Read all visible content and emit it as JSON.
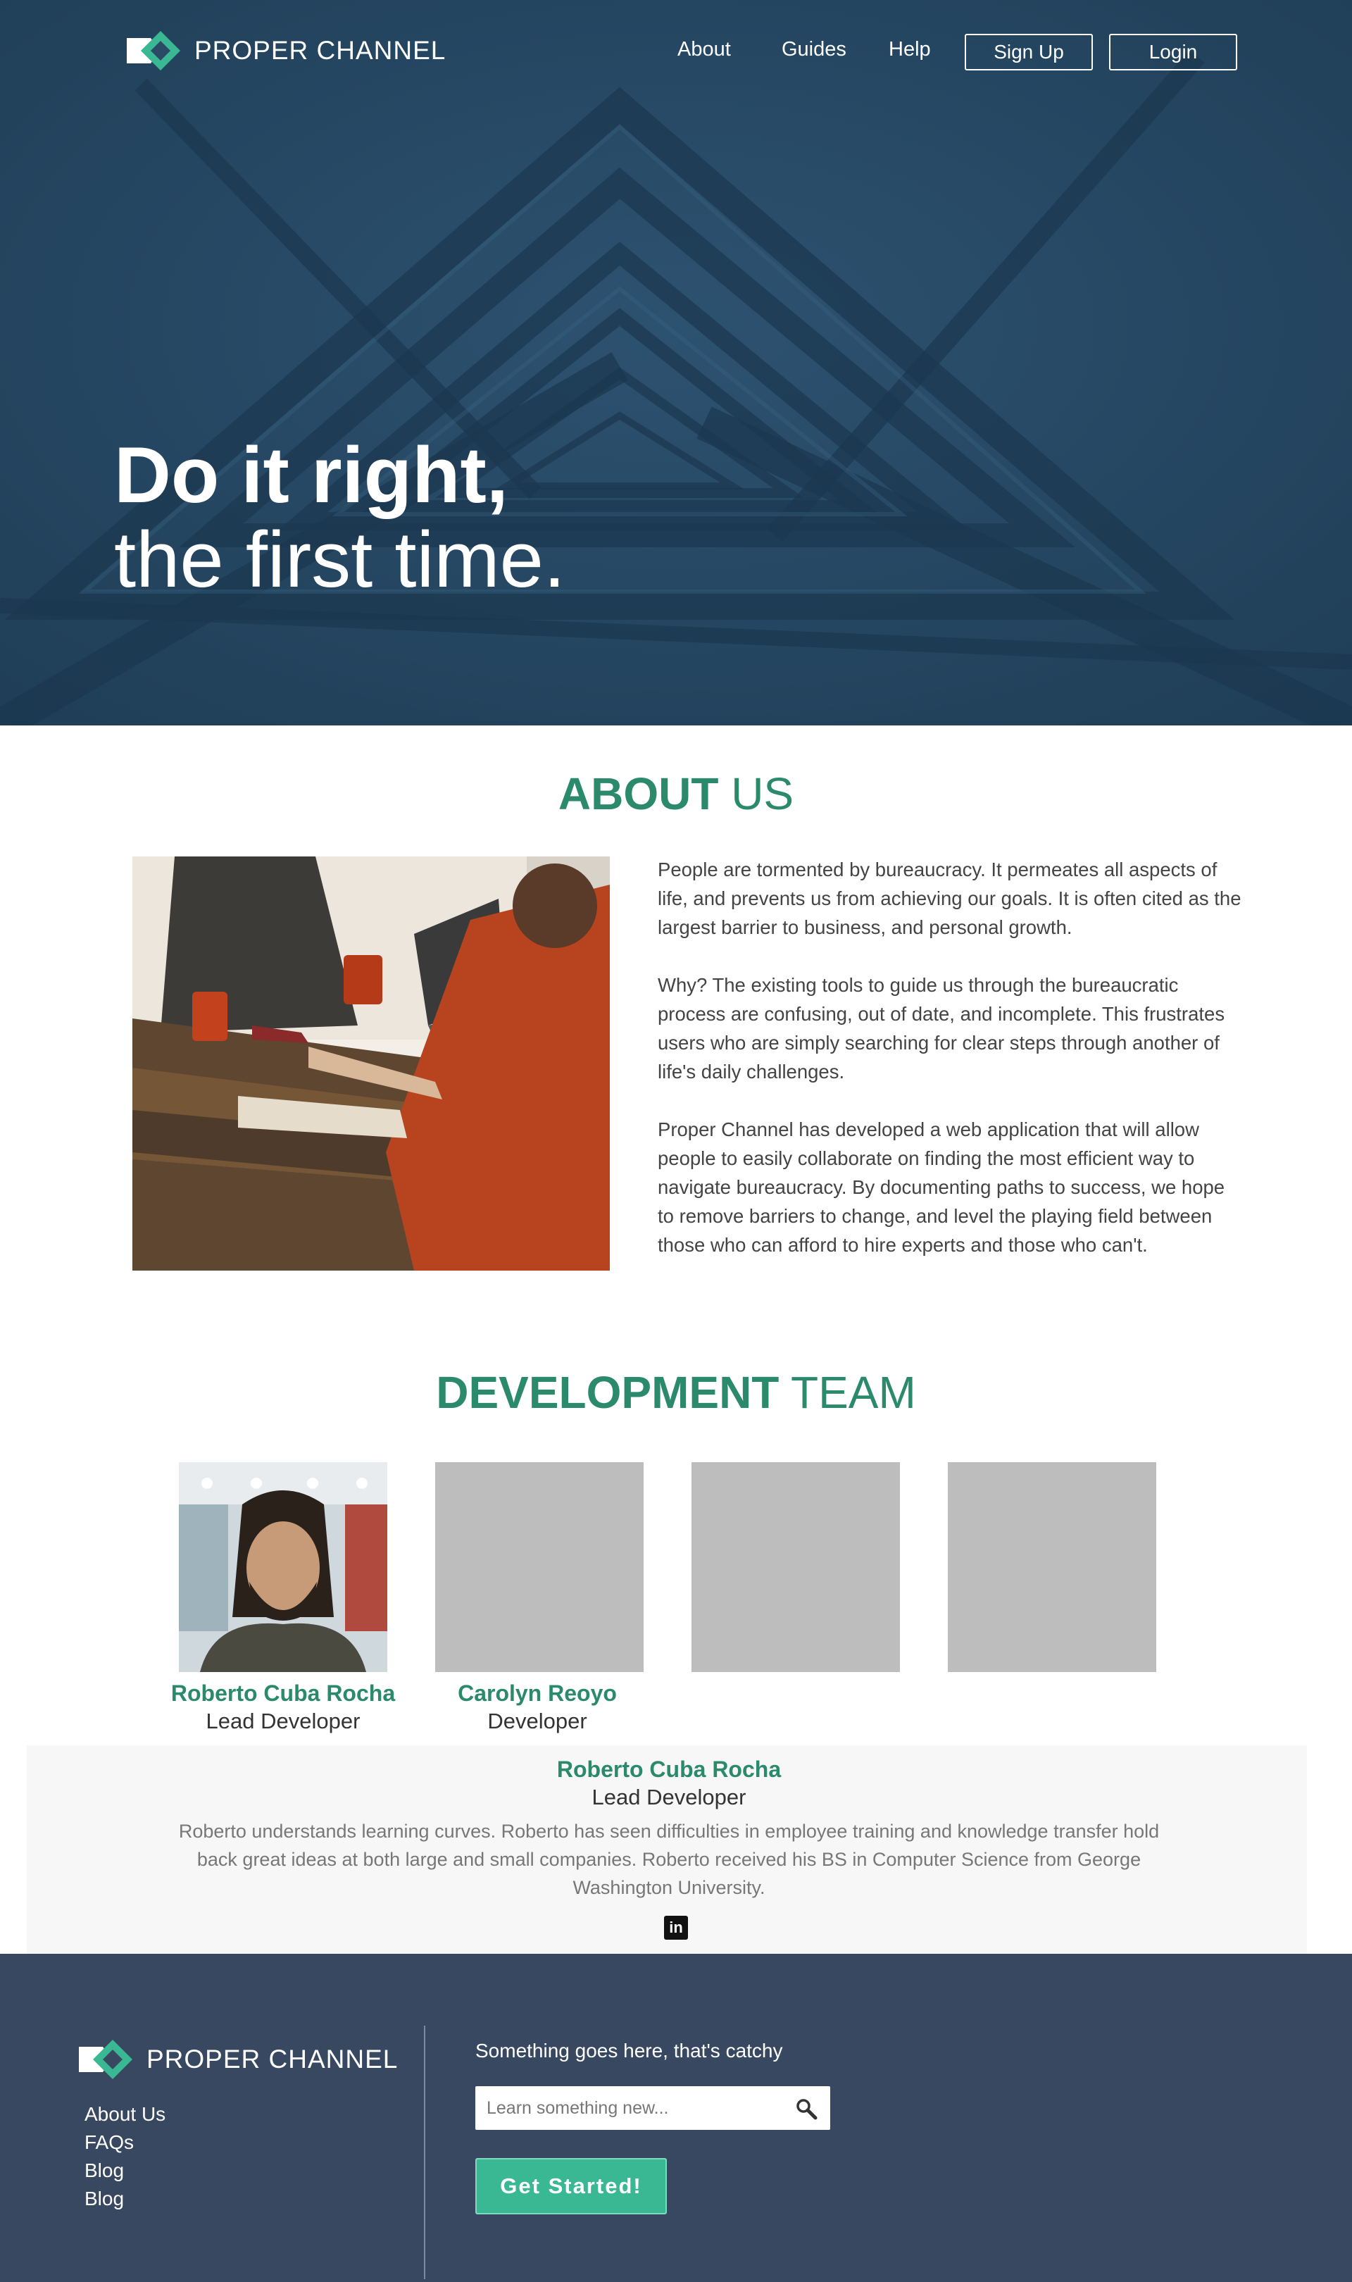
{
  "brand": {
    "name": "PROPER CHANNEL",
    "accent": "#2b8a6c",
    "logo_green": "#3ab894"
  },
  "nav": {
    "links": [
      "About",
      "Guides",
      "Help"
    ],
    "signup_label": "Sign Up",
    "login_label": "Login"
  },
  "hero": {
    "title_line1": "Do it right,",
    "title_line2": "the first time."
  },
  "about": {
    "heading_bold": "ABOUT",
    "heading_light": " US",
    "paragraphs": [
      "People are tormented by bureaucracy. It permeates all aspects of life, and prevents us from achieving our goals. It is often cited as the largest barrier to business, and personal growth.",
      "Why? The existing tools to guide us through the bureaucratic process are confusing, out of date, and incomplete. This frustrates users who are simply searching for clear steps through another of life's daily challenges.",
      "Proper Channel has developed a web application that will allow people to easily collaborate on finding the most efficient way to navigate bureaucracy. By documenting paths to success, we hope to remove barriers to change, and level the playing field between those who can afford to hire experts and those who can't."
    ]
  },
  "team": {
    "heading_bold": "DEVELOPMENT",
    "heading_light": " TEAM",
    "members": [
      {
        "name": "Roberto Cuba Rocha",
        "role": "Lead Developer"
      },
      {
        "name": "Carolyn Reoyo",
        "role": "Developer"
      }
    ],
    "selected": {
      "name": "Roberto Cuba Rocha",
      "role": "Lead Developer",
      "bio": "Roberto understands learning curves. Roberto has seen difficulties in employee training and knowledge transfer hold back great ideas at both large and small companies. Roberto received his BS in Computer Science from George Washington University.",
      "social_icon": "linkedin-icon"
    }
  },
  "footer": {
    "brand": "PROPER CHANNEL",
    "links": [
      "About Us",
      "FAQs",
      "Blog",
      "Blog"
    ],
    "tagline": "Something goes here, that's catchy",
    "search_placeholder": "Learn something new...",
    "cta_label": "Get Started!"
  }
}
